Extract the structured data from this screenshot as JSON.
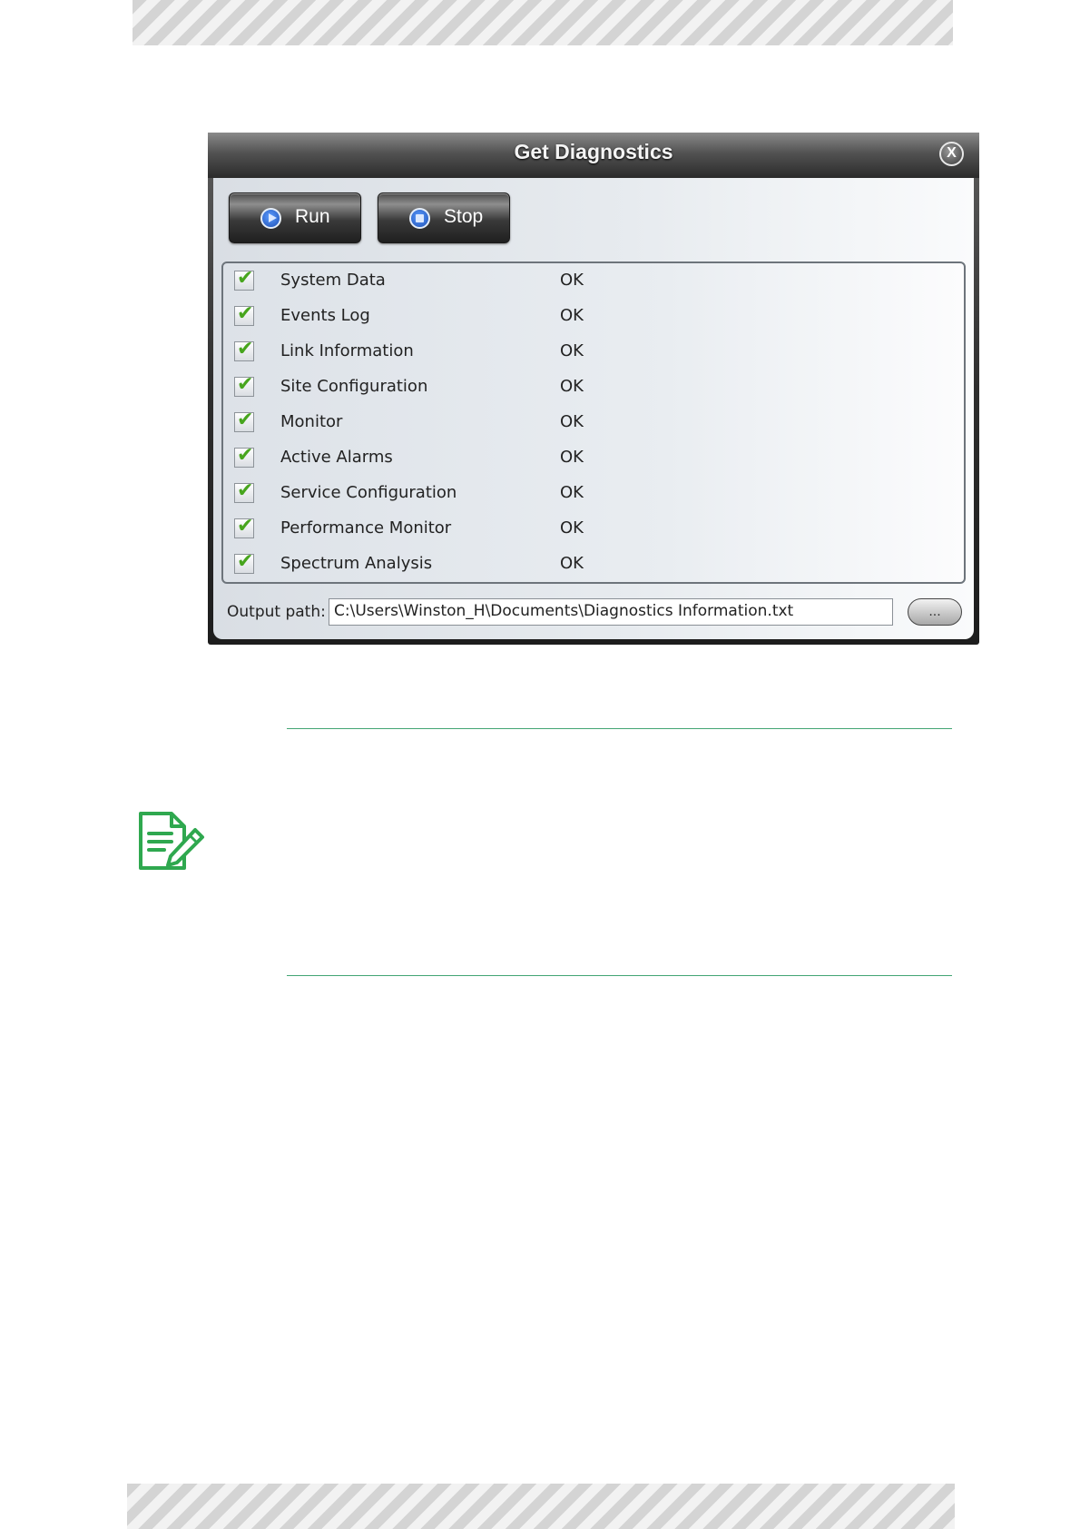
{
  "dialog": {
    "title": "Get Diagnostics",
    "close_glyph": "X",
    "run_label": "Run",
    "stop_label": "Stop",
    "items": [
      {
        "name": "System Data",
        "status": "OK"
      },
      {
        "name": "Events Log",
        "status": "OK"
      },
      {
        "name": "Link Information",
        "status": "OK"
      },
      {
        "name": "Site Configuration",
        "status": "OK"
      },
      {
        "name": "Monitor",
        "status": "OK"
      },
      {
        "name": "Active Alarms",
        "status": "OK"
      },
      {
        "name": "Service Configuration",
        "status": "OK"
      },
      {
        "name": "Performance Monitor",
        "status": "OK"
      },
      {
        "name": "Spectrum Analysis",
        "status": "OK"
      }
    ],
    "output_label": "Output path:",
    "output_value": "C:\\Users\\Winston_H\\Documents\\Diagnostics Information.txt",
    "browse_label": "..."
  },
  "icons": {
    "note": "note-pencil-icon",
    "check": "checkmark-icon",
    "run": "play-circle-icon",
    "stop": "stop-circle-icon",
    "close": "close-circle-icon"
  },
  "colors": {
    "accent_green": "#43a574",
    "check_green": "#47a51d",
    "button_blue": "#2f6fe0"
  }
}
